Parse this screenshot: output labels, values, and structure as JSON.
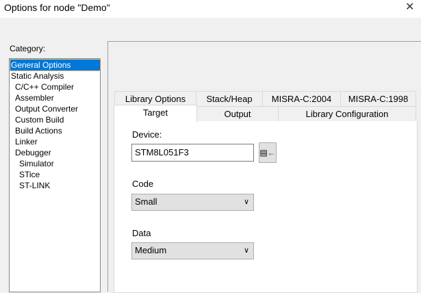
{
  "window": {
    "title": "Options for node \"Demo\"",
    "close": "✕"
  },
  "category": {
    "label": "Category:",
    "items": [
      "General Options",
      "Static Analysis",
      "C/C++ Compiler",
      "Assembler",
      "Output Converter",
      "Custom Build",
      "Build Actions",
      "Linker",
      "Debugger",
      "Simulator",
      "STice",
      "ST-LINK"
    ],
    "selected": 0
  },
  "tabs": {
    "row1": [
      "Library Options",
      "Stack/Heap",
      "MISRA-C:2004",
      "MISRA-C:1998"
    ],
    "row2": [
      "Target",
      "Output",
      "Library Configuration"
    ],
    "selected": "Target"
  },
  "target": {
    "device_label": "Device:",
    "device_value": "STM8L051F3",
    "code_label": "Code",
    "code_value": "Small",
    "data_label": "Data",
    "data_value": "Medium"
  }
}
